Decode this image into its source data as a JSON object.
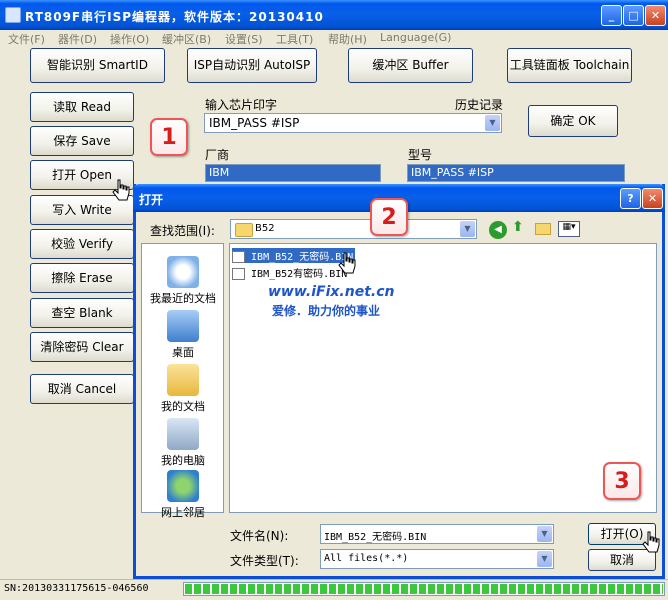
{
  "window": {
    "title": "RT809F串行ISP编程器，软件版本：20130410",
    "minimize_glyph": "_",
    "maximize_glyph": "□",
    "close_glyph": "✕"
  },
  "menu": {
    "items": [
      "文件(F)",
      "器件(D)",
      "操作(O)",
      "缓冲区(B)",
      "设置(S)",
      "工具(T)",
      "帮助(H)",
      "Language(G)"
    ]
  },
  "toolbar": {
    "smartid": "智能识别 SmartID",
    "autoisp": "ISP自动识别 AutoISP",
    "buffer": "缓冲区 Buffer",
    "toolchain": "工具链面板 Toolchain"
  },
  "side": {
    "read": "读取 Read",
    "save": "保存 Save",
    "open": "打开 Open",
    "write": "写入 Write",
    "verify": "校验 Verify",
    "erase": "擦除 Erase",
    "blank": "查空 Blank",
    "clear": "清除密码 Clear",
    "cancel": "取消 Cancel"
  },
  "chip": {
    "input_label": "输入芯片印字",
    "history_label": "历史记录",
    "input_value": "IBM_PASS #ISP",
    "ok_label": "确定 OK",
    "vendor_label": "厂商",
    "vendor_value": "IBM",
    "model_label": "型号",
    "model_value": "IBM_PASS #ISP"
  },
  "dialog": {
    "title": "打开",
    "help_glyph": "?",
    "close_glyph": "✕",
    "lookin_label": "查找范围(I):",
    "lookin_value": "B52",
    "places": [
      "我最近的文档",
      "桌面",
      "我的文档",
      "我的电脑",
      "网上邻居"
    ],
    "files": [
      "IBM_B52_无密码.BIN",
      "IBM_B52有密码.BIN"
    ],
    "filename_label": "文件名(N):",
    "filename_value": "IBM_B52_无密码.BIN",
    "filetype_label": "文件类型(T):",
    "filetype_value": "All files(*.*)",
    "open_button": "打开(O)",
    "cancel_button": "取消"
  },
  "watermark": {
    "url": "www.iFix.net.cn",
    "slogan": "爱修．助力你的事业"
  },
  "callouts": [
    "1",
    "2",
    "3"
  ],
  "status": {
    "sn": "SN:20130331175615-046560",
    "progress": 1.0
  },
  "colors": {
    "titlebar": "#0058EE",
    "callout_red": "#D71C1C",
    "selection": "#316AC5",
    "progress_green": "#3CC83C",
    "watermark_blue": "#1E55C8"
  },
  "icons": [
    "app-icon",
    "folder-icon",
    "back-icon",
    "up-folder-icon",
    "new-folder-icon",
    "view-menu-icon",
    "recent-docs-icon",
    "desktop-icon",
    "my-documents-icon",
    "my-computer-icon",
    "network-icon",
    "file-icon",
    "mouse-cursor-icon"
  ]
}
